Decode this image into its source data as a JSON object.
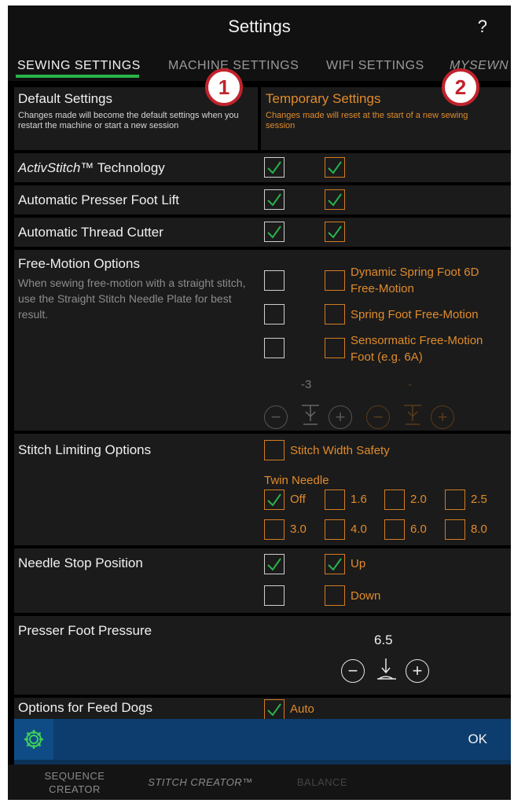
{
  "header": {
    "title": "Settings",
    "help": "?"
  },
  "tabs": [
    "SEWING SETTINGS",
    "MACHINE SETTINGS",
    "WIFI SETTINGS",
    "MYSEWN"
  ],
  "markers": [
    "1",
    "2"
  ],
  "defaults": {
    "title": "Default Settings",
    "desc": "Changes made will become the default settings when you restart the machine or start a new session"
  },
  "temporary": {
    "title": "Temporary Settings",
    "desc": "Changes made will reset at the start of a new sewing session"
  },
  "activstitch": {
    "italic": "ActivStitch",
    "rest": "™ Technology",
    "default_checked": true,
    "temp_checked": true
  },
  "presser_lift": {
    "label": "Automatic Presser Foot Lift",
    "default_checked": true,
    "temp_checked": true
  },
  "thread_cutter": {
    "label": "Automatic Thread Cutter",
    "default_checked": true,
    "temp_checked": true
  },
  "free_motion": {
    "label": "Free-Motion Options",
    "desc": "When sewing free-motion with a straight stitch, use the Straight Stitch Needle Plate for best result.",
    "options": [
      "Dynamic Spring Foot 6D Free-Motion",
      "Spring Foot Free-Motion",
      "Sensormatic Free-Motion Foot (e.g. 6A)"
    ],
    "height_value": "-3",
    "height_value_temp": "-"
  },
  "stitch_limiting": {
    "label": "Stitch Limiting Options",
    "width_safety": "Stitch Width Safety",
    "twin_needle_label": "Twin Needle",
    "twin_options": [
      "Off",
      "1.6",
      "2.0",
      "2.5",
      "3.0",
      "4.0",
      "6.0",
      "8.0"
    ],
    "twin_selected": "Off"
  },
  "needle_stop": {
    "label": "Needle Stop Position",
    "up": "Up",
    "down": "Down"
  },
  "presser_pressure": {
    "label": "Presser Foot Pressure",
    "value": "6.5"
  },
  "feed_dogs": {
    "label": "Options for Feed Dogs",
    "auto": "Auto"
  },
  "bottom_bar": {
    "ok": "OK"
  },
  "footer": {
    "sequence_line1": "SEQUENCE",
    "sequence_line2": "CREATOR",
    "stitch_creator": "STITCH CREATOR™",
    "balance": "BALANCE"
  },
  "colors": {
    "accent_green": "#29b34a",
    "temporary_orange": "#e08b2c",
    "bar_blue": "#0d3d6e",
    "marker_red": "#c0232c"
  }
}
